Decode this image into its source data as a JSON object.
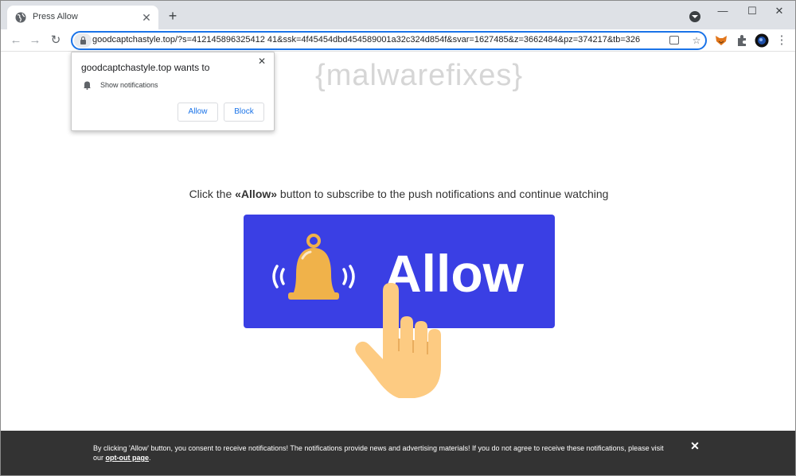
{
  "tab": {
    "title": "Press Allow",
    "close_glyph": "✕"
  },
  "newtab_glyph": "+",
  "window_controls": {
    "minimize": "—",
    "maximize": "☐",
    "close": "✕"
  },
  "toolbar": {
    "back_glyph": "←",
    "forward_glyph": "→",
    "reload_glyph": "↻",
    "url": "goodcaptchastyle.top/?s=412145896325412 41&ssk=4f45454dbd454589001a32c324d854f&svar=1627485&z=3662484&pz=374217&tb=326",
    "star_glyph": "☆",
    "menu_glyph": "⋮"
  },
  "watermark": "{malwarefixes}",
  "permission_popup": {
    "title": "goodcaptchastyle.top wants to",
    "item": "Show notifications",
    "allow_label": "Allow",
    "block_label": "Block",
    "close_glyph": "✕"
  },
  "page": {
    "headline_prefix": "Click the ",
    "headline_bold": "«Allow»",
    "headline_suffix": " button to subscribe to the push notifications and continue watching",
    "allow_image_text": "Allow"
  },
  "consent_bar": {
    "text": "By clicking 'Allow' button, you consent to receive notifications! The notifications provide news and advertising materials! If you do not agree to receive these notifications, please visit our ",
    "link": "opt-out page",
    "end": ".",
    "close_glyph": "✕"
  },
  "colors": {
    "accent": "#1a73e8",
    "allow_box": "#3a3fe4",
    "bell": "#f0b24a",
    "hand": "#fdcb82",
    "bottombar": "#333333"
  }
}
